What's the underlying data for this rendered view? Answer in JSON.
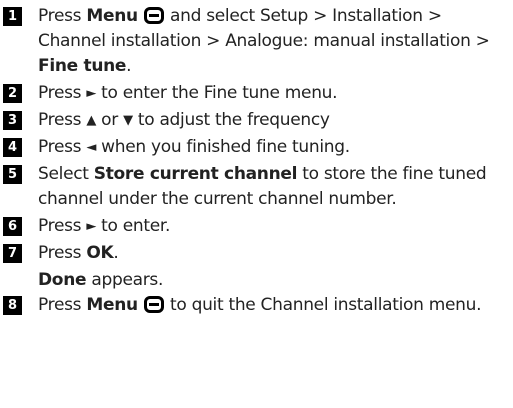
{
  "steps": [
    {
      "num": "1",
      "a": "Press ",
      "menu": "Menu",
      "b": " and select Setup > Installation > Channel installation > Analogue: manual installation > ",
      "fine_tune": "Fine tune",
      "c": ".",
      "icon": "menu-button-icon"
    },
    {
      "num": "2",
      "a": "Press ",
      "arrow": "►",
      "b": " to enter the Fine tune menu.",
      "icon": "right-arrow-icon"
    },
    {
      "num": "3",
      "a": "Press ",
      "arrow1": "▲",
      "b": " or ",
      "arrow2": "▼",
      "c": " to adjust the frequency",
      "icons": [
        "up-arrow-icon",
        "down-arrow-icon"
      ]
    },
    {
      "num": "4",
      "a": "Press ",
      "arrow": "◄",
      "b": " when you finished fine tuning.",
      "icon": "left-arrow-icon"
    },
    {
      "num": "5",
      "a": "Select ",
      "bold": "Store current channel",
      "b": " to store the fine tuned channel under the current channel number."
    },
    {
      "num": "6",
      "a": "Press ",
      "arrow": "►",
      "b": " to enter.",
      "icon": "right-arrow-icon"
    },
    {
      "num": "7",
      "a": "Press ",
      "ok": "OK",
      "b": ".",
      "done": "Done",
      "done_rest": " appears."
    },
    {
      "num": "8",
      "a": "Press ",
      "menu": "Menu",
      "b": " to quit the Channel installation menu.",
      "icon": "menu-button-icon"
    }
  ]
}
